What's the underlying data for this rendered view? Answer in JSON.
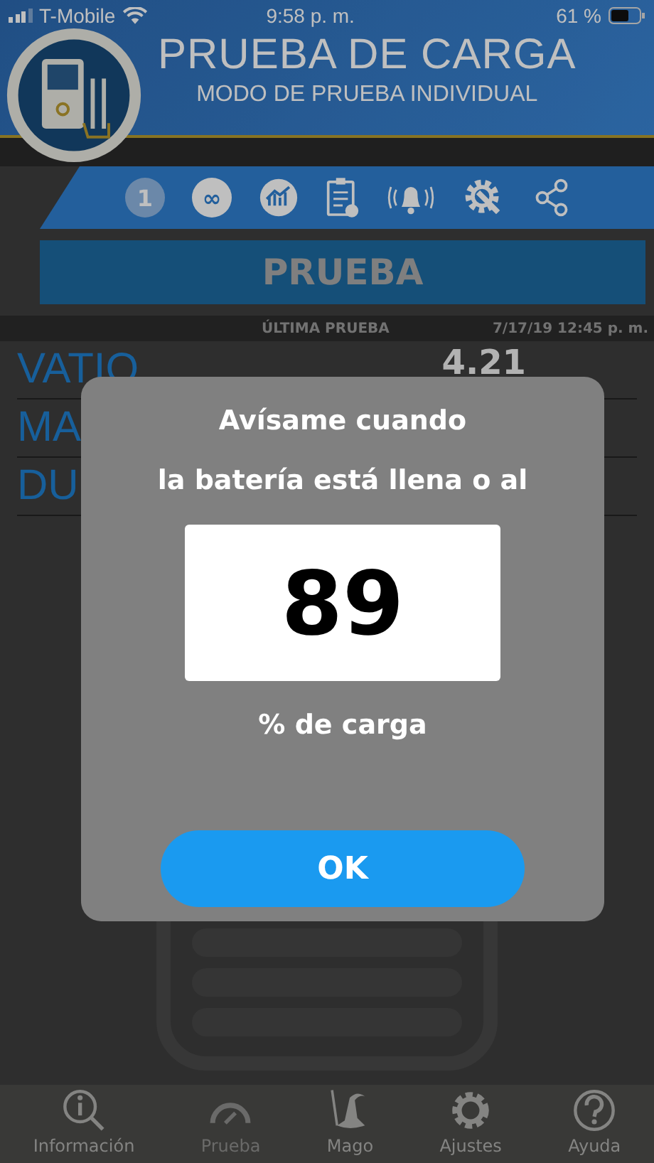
{
  "status_bar": {
    "carrier": "T-Mobile",
    "time": "9:58 p. m.",
    "battery": "61 %"
  },
  "header": {
    "title": "PRUEBA DE CARGA",
    "subtitle": "MODO DE PRUEBA INDIVIDUAL"
  },
  "toolbar": [
    {
      "kind": "number",
      "label": "1",
      "selected": true
    },
    {
      "kind": "infinity",
      "label": "∞",
      "selected": false
    },
    {
      "kind": "chart",
      "selected": false
    },
    {
      "kind": "clipboard",
      "selected": false
    },
    {
      "kind": "bell",
      "selected": false
    },
    {
      "kind": "settings",
      "selected": false
    },
    {
      "kind": "share",
      "selected": false
    }
  ],
  "section_title": "PRUEBA",
  "last_test": {
    "label": "ÚLTIMA PRUEBA",
    "date": "7/17/19 12:45 p. m."
  },
  "readings": [
    {
      "label": "VATIO",
      "value": "4.21"
    },
    {
      "label": "MA"
    },
    {
      "label": "DU"
    }
  ],
  "dialog": {
    "line_1": "Avísame cuando",
    "line_2": "la batería está llena o al",
    "value": "89",
    "line_3": "% de carga",
    "button": "OK"
  },
  "tabs": [
    {
      "kind": "info",
      "label": "Información",
      "selected": false
    },
    {
      "kind": "gauge",
      "label": "Prueba",
      "selected": true
    },
    {
      "kind": "wizard",
      "label": "Mago",
      "selected": false
    },
    {
      "kind": "gear",
      "label": "Ajustes",
      "selected": false
    },
    {
      "kind": "help",
      "label": "Ayuda",
      "selected": false
    }
  ]
}
